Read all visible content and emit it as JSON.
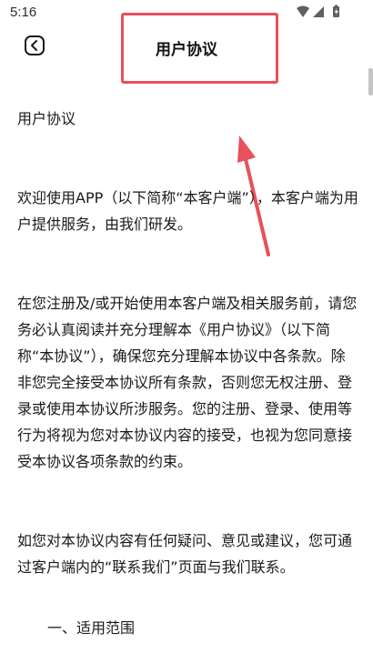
{
  "status_bar": {
    "time": "5:16",
    "icons": [
      "wifi-icon",
      "cellular-signal-icon",
      "battery-icon"
    ]
  },
  "nav": {
    "back_icon": "chevron-left-icon",
    "title": "用户协议"
  },
  "annotation": {
    "highlight_color": "#e8505b",
    "arrow_color": "#e8505b"
  },
  "content": {
    "heading": "用户协议",
    "paragraphs": [
      "欢迎使用APP（以下简称“本客户端”），本客户端为用户提供服务，由我们研发。",
      "在您注册及/或开始使用本客户端及相关服务前，请您务必认真阅读并充分理解本《用户协议》（以下简称“本协议”），确保您充分理解本协议中各条款。除非您完全接受本协议所有条款，否则您无权注册、登录或使用本协议所涉服务。您的注册、登录、使用等行为将视为您对本协议内容的接受，也视为您同意接受本协议各项条款的约束。",
      "如您对本协议内容有任何疑问、意见或建议，您可通过客户端内的“联系我们”页面与我们联系。"
    ],
    "section_partial": "一、适用范围"
  }
}
